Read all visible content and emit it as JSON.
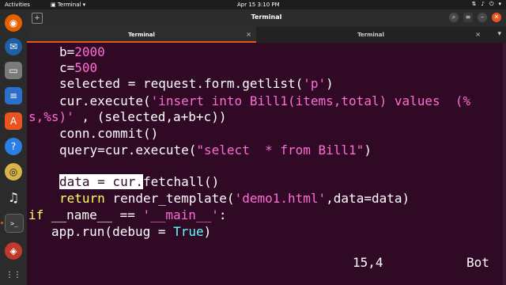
{
  "topbar": {
    "activities": "Activities",
    "app_name": "Terminal",
    "clock": "Apr 15  3:10 PM"
  },
  "window": {
    "title": "Terminal"
  },
  "tabs": [
    {
      "label": "Terminal",
      "active": true
    },
    {
      "label": "Terminal",
      "active": false
    }
  ],
  "code": {
    "line1": {
      "a": "b=",
      "b": "2000"
    },
    "line2": {
      "a": "c=",
      "b": "500"
    },
    "line3": {
      "a": "selected = request.form.getlist(",
      "b": "'p'",
      "c": ")"
    },
    "line4": {
      "a": "cur.execute(",
      "b": "'insert into Bill1(items,total) values  (%"
    },
    "line5": {
      "a": "s,%s)'",
      "b": " , (selected,a+b+c))"
    },
    "line6": "conn.commit()",
    "line7": {
      "a": "query=cur.execute(",
      "b": "\"select  * from Bill1\"",
      "c": ")"
    },
    "line8": {
      "hl": "data = cur.",
      "b": "fetchall()"
    },
    "line9": {
      "kw": "return",
      "a": " render_template(",
      "b": "'demo1.html'",
      "c": ",data=data)"
    },
    "line10": {
      "kw": "if",
      "a": " __name__ == ",
      "b": "'__main__'",
      "c": ":"
    },
    "line11": {
      "a": "app.run(debug = ",
      "b": "True",
      "c": ")"
    }
  },
  "status": {
    "position": "15,4",
    "scroll": "Bot"
  },
  "colors": {
    "background": "#300a24",
    "accent": "#e95420",
    "string": "#ff6bd6",
    "keyword": "#ffff5f",
    "constant": "#5fffff"
  }
}
